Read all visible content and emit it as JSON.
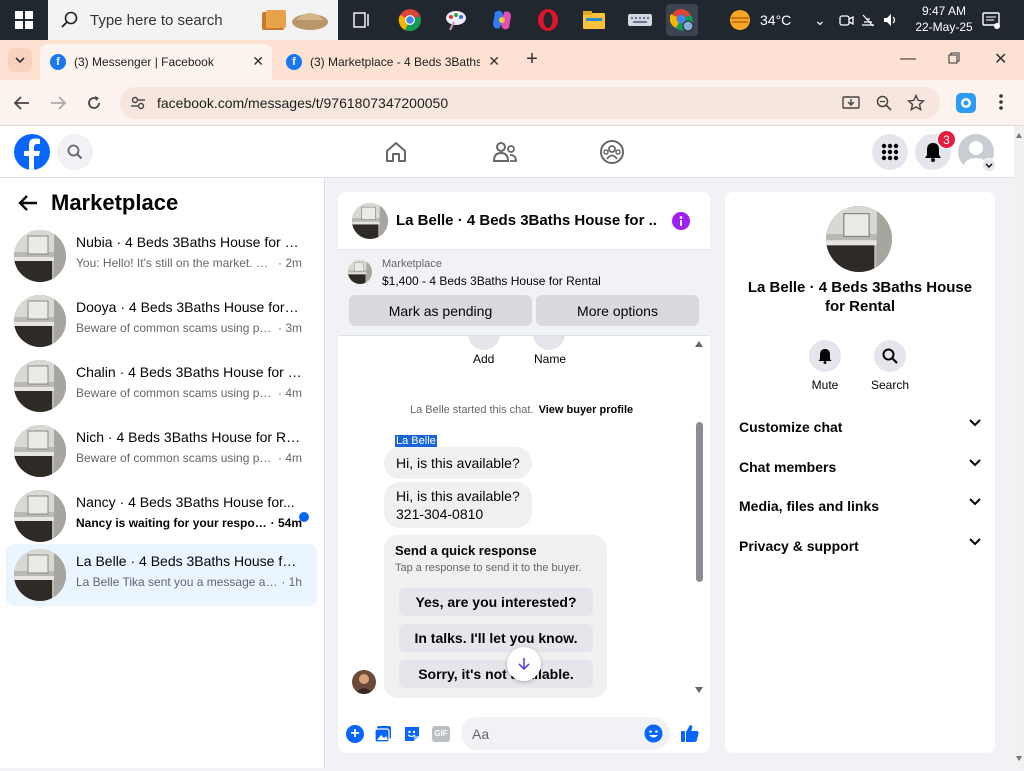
{
  "taskbar": {
    "search_placeholder": "Type here to search",
    "weather": "34°C",
    "time": "9:47 AM",
    "date": "22-May-25"
  },
  "browser": {
    "tabs": [
      {
        "title": "(3) Messenger | Facebook",
        "active": true
      },
      {
        "title": "(3) Marketplace - 4 Beds 3Baths",
        "active": false
      }
    ],
    "new_tab": "+",
    "url": "facebook.com/messages/t/9761807347200050"
  },
  "fb_header": {
    "notification_count": "3",
    "brand_color": "#0866ff"
  },
  "sidebar": {
    "title": "Marketplace",
    "conversations": [
      {
        "name": "Nubia · 4 Beds 3Baths House for R...",
        "snippet": "You: Hello! It's still on the market. Pro...",
        "time": "· 2m",
        "unread": false,
        "selected": false
      },
      {
        "name": "Dooya · 4 Beds 3Baths House for R...",
        "snippet": "Beware of common scams using pay...",
        "time": "· 3m",
        "unread": false,
        "selected": false
      },
      {
        "name": "Chalin · 4 Beds 3Baths House for R...",
        "snippet": "Beware of common scams using pay...",
        "time": "· 4m",
        "unread": false,
        "selected": false
      },
      {
        "name": "Nich · 4 Beds 3Baths House for Re...",
        "snippet": "Beware of common scams using pay...",
        "time": "· 4m",
        "unread": false,
        "selected": false
      },
      {
        "name": "Nancy · 4 Beds 3Baths House for...",
        "snippet": "Nancy is waiting for your respon...",
        "time": "· 54m",
        "unread": true,
        "selected": false
      },
      {
        "name": "La Belle · 4 Beds 3Baths House for ...",
        "snippet": "La Belle Tika sent you a message abo...",
        "time": "· 1h",
        "unread": false,
        "selected": true
      }
    ]
  },
  "chat": {
    "title": "La Belle · 4 Beds 3Baths House for ...",
    "listing_source": "Marketplace",
    "listing_title": "$1,400 - 4 Beds 3Baths House for Rental",
    "mark_pending": "Mark as pending",
    "more_options": "More options",
    "action_add": "Add",
    "action_name": "Name",
    "started_text": "La Belle started this chat.",
    "view_profile": "View buyer profile",
    "sender_label": "La Belle",
    "messages": [
      "Hi, is this available?",
      "Hi, is this available?",
      "321-304-0810"
    ],
    "quick_title": "Send a quick response",
    "quick_sub": "Tap a response to send it to the buyer.",
    "quick_replies": [
      "Yes, are you interested?",
      "In talks. I'll let you know.",
      "Sorry, it's not available."
    ],
    "composer_placeholder": "Aa",
    "gif_label": "GIF"
  },
  "details": {
    "title": "La Belle · 4 Beds 3Baths House for Rental",
    "mute": "Mute",
    "search": "Search",
    "sections": [
      "Customize chat",
      "Chat members",
      "Media, files and links",
      "Privacy & support"
    ]
  }
}
